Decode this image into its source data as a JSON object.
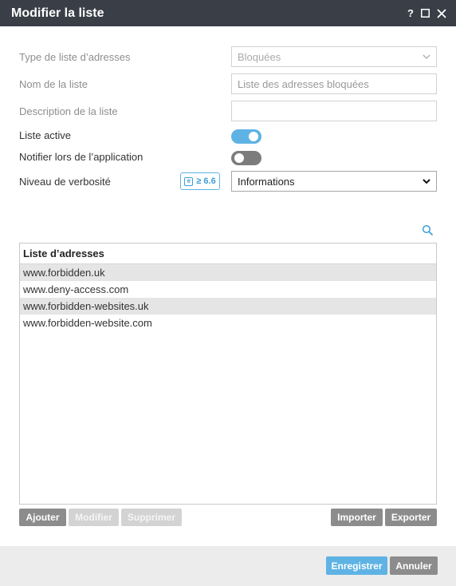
{
  "dialog": {
    "title": "Modifier la liste"
  },
  "form": {
    "type_label": "Type de liste d’adresses",
    "type_value": "Bloquées",
    "name_label": "Nom de la liste",
    "name_placeholder": "Liste des adresses bloquées",
    "description_label": "Description de la liste",
    "description_value": "",
    "active_label": "Liste active",
    "active_on": true,
    "notify_label": "Notifier lors de l’application",
    "notify_on": false,
    "verbosity_label": "Niveau de verbosité",
    "verbosity_badge": "≥ 6.6",
    "verbosity_value": "Informations"
  },
  "list": {
    "header": "Liste d’adresses",
    "rows": [
      {
        "text": "www.forbidden.uk",
        "selected": true
      },
      {
        "text": "www.deny-access.com",
        "selected": false
      },
      {
        "text": "www.forbidden-websites.uk",
        "selected": true
      },
      {
        "text": "www.forbidden-website.com",
        "selected": false
      }
    ]
  },
  "list_buttons": {
    "add": "Ajouter",
    "edit": "Modifier",
    "delete": "Supprimer",
    "import": "Importer",
    "export": "Exporter"
  },
  "footer": {
    "save": "Enregistrer",
    "cancel": "Annuler"
  },
  "colors": {
    "titlebar": "#3a3e46",
    "accent": "#5eb3e4",
    "button_gray": "#8c8c8c"
  },
  "icons": [
    "help-icon",
    "maximize-icon",
    "close-icon",
    "chevron-down-icon",
    "search-icon",
    "badge-icon"
  ]
}
